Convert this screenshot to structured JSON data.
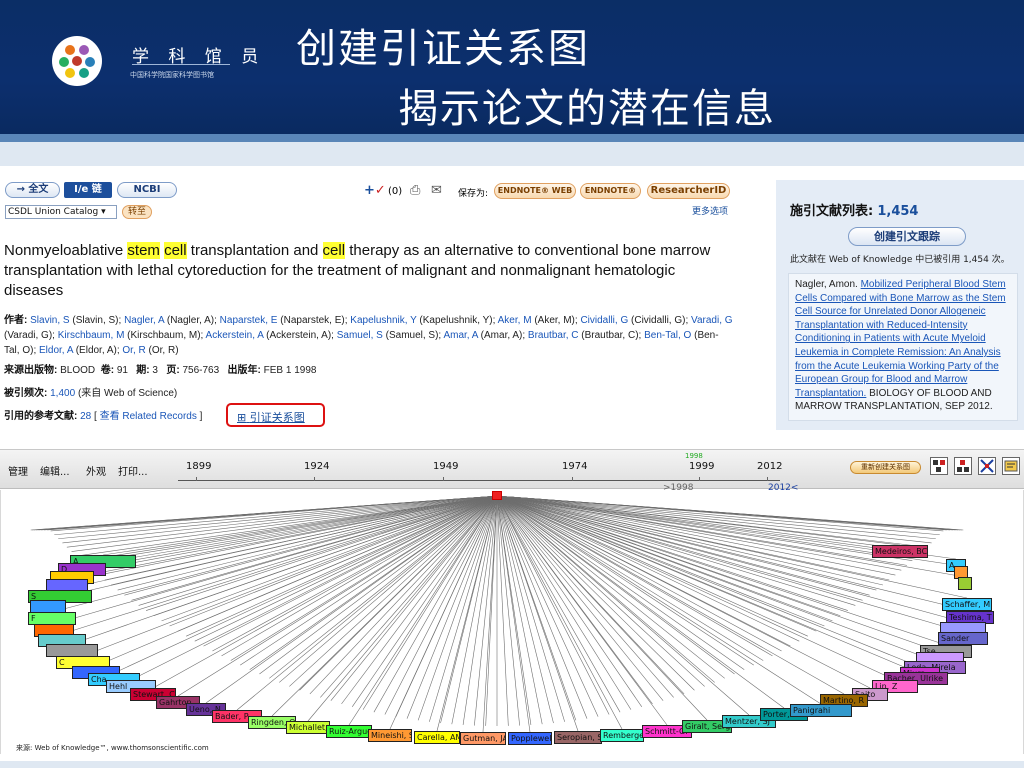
{
  "header": {
    "logo_name": "学 科 馆 员",
    "logo_sub": "中国科学院国家科学图书馆",
    "title_line1": "创建引证关系图",
    "title_line2": "揭示论文的潜在信息"
  },
  "toolbar": {
    "fulltext": "→ 全文",
    "linker": "Ⅰ/e 链",
    "ncbi": "NCBI",
    "catalog": "CSDL Union Catalog ▾",
    "transfer": "转至",
    "marked": "(0)",
    "save_as": "保存为:",
    "endnote_web": "ENDNOTE® WEB",
    "endnote": "ENDNOTE®",
    "researcherid": "ResearcherID",
    "more_options": "更多选项"
  },
  "record": {
    "title_part1": "Nonmyeloablative ",
    "title_hl1": "stem",
    "title_sp1": " ",
    "title_hl2": "cell",
    "title_part2": " transplantation and ",
    "title_hl3": "cell",
    "title_part3": " therapy as an alternative to conventional bone marrow transplantation with lethal cytoreduction for the treatment of malignant and nonmalignant hematologic diseases",
    "authors_label": "作者:",
    "authors": [
      {
        "link": "Slavin, S",
        "full": " (Slavin, S); "
      },
      {
        "link": "Nagler, A",
        "full": " (Nagler, A); "
      },
      {
        "link": "Naparstek, E",
        "full": " (Naparstek, E); "
      },
      {
        "link": "Kapelushnik, Y",
        "full": " (Kapelushnik, Y); "
      },
      {
        "link": "Aker, M",
        "full": " (Aker, M); "
      },
      {
        "link": "Cividalli, G",
        "full": " (Cividalli, G); "
      },
      {
        "link": "Varadi, G",
        "full": " (Varadi, G); "
      },
      {
        "link": "Kirschbaum, M",
        "full": " (Kirschbaum, M); "
      },
      {
        "link": "Ackerstein, A",
        "full": " (Ackerstein, A); "
      },
      {
        "link": "Samuel, S",
        "full": " (Samuel, S); "
      },
      {
        "link": "Amar, A",
        "full": " (Amar, A); "
      },
      {
        "link": "Brautbar, C",
        "full": " (Brautbar, C); "
      },
      {
        "link": "Ben-Tal, O",
        "full": " (Ben-Tal, O); "
      },
      {
        "link": "Eldor, A",
        "full": " (Eldor, A); "
      },
      {
        "link": "Or, R",
        "full": " (Or, R)"
      }
    ],
    "source_label": "来源出版物:",
    "source": "BLOOD",
    "vol_label": "卷:",
    "vol": "91",
    "issue_label": "期:",
    "issue": "3",
    "pages_label": "页:",
    "pages": "756-763",
    "year_label": "出版年:",
    "year": "FEB 1 1998",
    "cited_label": "被引频次:",
    "cited_count": "1,400",
    "cited_source": "(来自  Web of Science)",
    "refs_label": "引用的参考文献:",
    "refs_count": "28",
    "refs_open": "[",
    "refs_view": "查看",
    "refs_related": "Related Records",
    "refs_close": "]",
    "citemap_label": "引证关系图"
  },
  "citing_panel": {
    "heading": "施引文献列表:",
    "count": "1,454",
    "create_alert": "创建引文跟踪",
    "note": "此文献在  Web of Knowledge 中已被引用  1,454 次。",
    "latest_author": "Nagler, Amon.",
    "latest_title": "Mobilized Peripheral Blood Stem Cells Compared with Bone Marrow as the Stem Cell Source for Unrelated Donor Allogeneic Transplantation with Reduced-Intensity Conditioning in Patients with Acute Myeloid Leukemia in Complete Remission: An Analysis from the Acute Leukemia Working Party of the European Group for Blood and Marrow Transplantation.",
    "latest_source": " BIOLOGY OF BLOOD AND MARROW TRANSPLANTATION, SEP 2012."
  },
  "citation_map": {
    "menu": [
      "管理",
      "编辑...",
      "外观",
      "打印..."
    ],
    "years": [
      "1899",
      "1924",
      "1949",
      "1974",
      "1999",
      "2012"
    ],
    "pub_year_marker": "1998",
    "range_start": ">1998",
    "range_end": "2012<",
    "rebuild": "重新创建关系图",
    "left_nodes": [
      {
        "label": "A",
        "color": "#33cc66"
      },
      {
        "label": "D",
        "color": "#9933cc"
      },
      {
        "label": "",
        "color": "#ffcc00"
      },
      {
        "label": "",
        "color": "#6666ff"
      },
      {
        "label": "S",
        "color": "#33cc33"
      },
      {
        "label": "",
        "color": "#3399ff"
      },
      {
        "label": "F",
        "color": "#66ff66"
      },
      {
        "label": "",
        "color": "#ff6600"
      },
      {
        "label": "",
        "color": "#66cccc"
      },
      {
        "label": "",
        "color": "#999999"
      },
      {
        "label": "C",
        "color": "#ffff33"
      },
      {
        "label": "",
        "color": "#3366ff"
      },
      {
        "label": "Cha",
        "color": "#33ccff"
      },
      {
        "label": "Hehl",
        "color": "#99ccff"
      },
      {
        "label": "Stewart, C",
        "color": "#cc0033"
      },
      {
        "label": "Gahrton",
        "color": "#993366"
      },
      {
        "label": "Ueno, N",
        "color": "#663399"
      },
      {
        "label": "Bader, P",
        "color": "#ff3366"
      }
    ],
    "bottom_nodes": [
      {
        "label": "Ringden, O",
        "color": "#99ff66"
      },
      {
        "label": "Michallet, M",
        "color": "#ccff33"
      },
      {
        "label": "Ruiz-Arguell",
        "color": "#33ff33"
      },
      {
        "label": "Mineishi, S",
        "color": "#ff9933"
      },
      {
        "label": "Carella, AM",
        "color": "#ffff00"
      },
      {
        "label": "Gutman, JA",
        "color": "#ff9966"
      },
      {
        "label": "Popplewell",
        "color": "#3366ff"
      },
      {
        "label": "Seropian, S",
        "color": "#996666"
      },
      {
        "label": "Remberger",
        "color": "#33ffcc"
      },
      {
        "label": "Schmitt-Gr",
        "color": "#ff33cc"
      },
      {
        "label": "Giralt, Sergio",
        "color": "#33cc66"
      },
      {
        "label": "Mentzer, SJ",
        "color": "#33cccc"
      },
      {
        "label": "Porter, DL",
        "color": "#009999"
      }
    ],
    "right_nodes": [
      {
        "label": "Medeiros, BC",
        "color": "#cc3366"
      },
      {
        "label": "A.",
        "color": "#33ccff"
      },
      {
        "label": "",
        "color": "#ff9933"
      },
      {
        "label": "",
        "color": "#99cc33"
      },
      {
        "label": "Schaffer, M",
        "color": "#33ccff"
      },
      {
        "label": "Teshima, T",
        "color": "#6633cc"
      },
      {
        "label": "",
        "color": "#9999ff"
      },
      {
        "label": "Sander",
        "color": "#6666cc"
      },
      {
        "label": "Tse",
        "color": "#999999"
      },
      {
        "label": "",
        "color": "#cc99ff"
      },
      {
        "label": "Leda, Mirela",
        "color": "#9966cc"
      },
      {
        "label": "Miura",
        "color": "#cc33cc"
      },
      {
        "label": "Bacher, Ulrike",
        "color": "#993399"
      },
      {
        "label": "Lin, Z",
        "color": "#ff66cc"
      },
      {
        "label": "Saito",
        "color": "#cc99cc"
      },
      {
        "label": "Martino, R",
        "color": "#996600"
      },
      {
        "label": "Panigrahi",
        "color": "#3399cc"
      }
    ],
    "footer": "来源: Web of Knowledge™, www.thomsonscientific.com"
  }
}
